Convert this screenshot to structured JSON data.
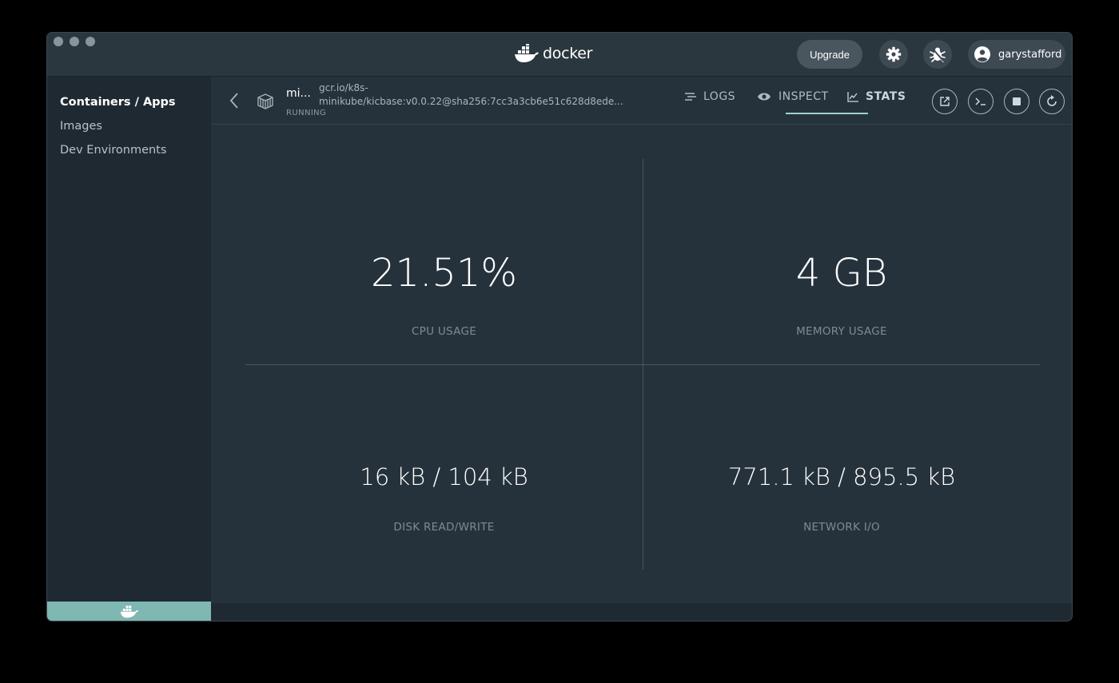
{
  "titlebar": {
    "logo_text": "docker",
    "upgrade_label": "Upgrade",
    "username": "garystafford"
  },
  "sidebar": {
    "items": [
      {
        "label": "Containers / Apps",
        "active": true
      },
      {
        "label": "Images",
        "active": false
      },
      {
        "label": "Dev Environments",
        "active": false
      }
    ]
  },
  "container": {
    "name": "mi...",
    "image": "gcr.io/k8s-minikube/kicbase:v0.0.22@sha256:7cc3a3cb6e51c628d8ede...",
    "status": "RUNNING"
  },
  "tabs": [
    {
      "label": "LOGS",
      "icon": "logs-icon"
    },
    {
      "label": "INSPECT",
      "icon": "eye-icon"
    },
    {
      "label": "STATS",
      "icon": "chart-icon",
      "active": true
    }
  ],
  "stats": {
    "cpu": {
      "value": "21.51%",
      "label": "CPU USAGE"
    },
    "memory": {
      "value": "4 GB",
      "label": "MEMORY USAGE"
    },
    "disk": {
      "value": "16 kB / 104 kB",
      "label": "DISK READ/WRITE"
    },
    "network": {
      "value": "771.1 kB / 895.5 kB",
      "label": "NETWORK I/O"
    }
  },
  "colors": {
    "window_bg": "#26323b",
    "sidebar_bg": "#1f2931",
    "accent": "#9fd0ce",
    "whale_bar": "#7fb7b2"
  }
}
